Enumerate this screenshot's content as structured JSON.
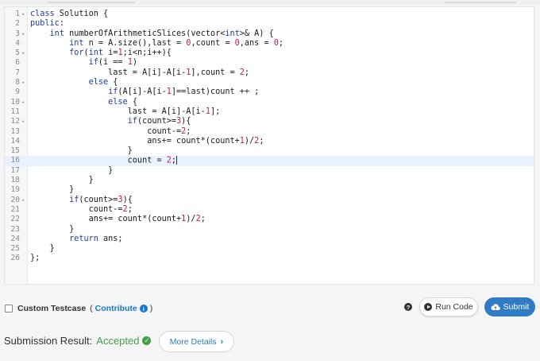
{
  "editor": {
    "active_line": 16,
    "lines": [
      {
        "n": "1",
        "fold": true,
        "tokens": [
          [
            "kw",
            "class"
          ],
          [
            "t",
            " Solution {"
          ]
        ]
      },
      {
        "n": "2",
        "fold": false,
        "tokens": [
          [
            "kw",
            "public"
          ],
          [
            "t",
            ":"
          ]
        ]
      },
      {
        "n": "3",
        "fold": true,
        "tokens": [
          [
            "t",
            "    "
          ],
          [
            "kw",
            "int"
          ],
          [
            "t",
            " numberOfArithmeticSlices(vector<"
          ],
          [
            "kw",
            "int"
          ],
          [
            "t",
            ">& A) {"
          ]
        ]
      },
      {
        "n": "4",
        "fold": false,
        "tokens": [
          [
            "t",
            "        "
          ],
          [
            "kw",
            "int"
          ],
          [
            "t",
            " n = A.size(),last = "
          ],
          [
            "num",
            "0"
          ],
          [
            "t",
            ",count = "
          ],
          [
            "num",
            "0"
          ],
          [
            "t",
            ",ans = "
          ],
          [
            "num",
            "0"
          ],
          [
            "t",
            ";"
          ]
        ]
      },
      {
        "n": "5",
        "fold": true,
        "tokens": [
          [
            "t",
            "        "
          ],
          [
            "kw",
            "for"
          ],
          [
            "t",
            "("
          ],
          [
            "kw",
            "int"
          ],
          [
            "t",
            " i="
          ],
          [
            "num",
            "1"
          ],
          [
            "t",
            ";i<n;i++){"
          ]
        ]
      },
      {
        "n": "6",
        "fold": false,
        "tokens": [
          [
            "t",
            "            "
          ],
          [
            "kw",
            "if"
          ],
          [
            "t",
            "(i == "
          ],
          [
            "num",
            "1"
          ],
          [
            "t",
            ")"
          ]
        ]
      },
      {
        "n": "7",
        "fold": false,
        "tokens": [
          [
            "t",
            "                last = A[i]-A[i-"
          ],
          [
            "num",
            "1"
          ],
          [
            "t",
            "],count = "
          ],
          [
            "num",
            "2"
          ],
          [
            "t",
            ";"
          ]
        ]
      },
      {
        "n": "8",
        "fold": true,
        "tokens": [
          [
            "t",
            "            "
          ],
          [
            "kw",
            "else"
          ],
          [
            "t",
            " {"
          ]
        ]
      },
      {
        "n": "9",
        "fold": false,
        "tokens": [
          [
            "t",
            "                "
          ],
          [
            "kw",
            "if"
          ],
          [
            "t",
            "(A[i]-A[i-"
          ],
          [
            "num",
            "1"
          ],
          [
            "t",
            "]==last)count ++ ;"
          ]
        ]
      },
      {
        "n": "10",
        "fold": true,
        "tokens": [
          [
            "t",
            "                "
          ],
          [
            "kw",
            "else"
          ],
          [
            "t",
            " {"
          ]
        ]
      },
      {
        "n": "11",
        "fold": false,
        "tokens": [
          [
            "t",
            "                    last = A[i]-A[i-"
          ],
          [
            "num",
            "1"
          ],
          [
            "t",
            "];"
          ]
        ]
      },
      {
        "n": "12",
        "fold": true,
        "tokens": [
          [
            "t",
            "                    "
          ],
          [
            "kw",
            "if"
          ],
          [
            "t",
            "(count>="
          ],
          [
            "num",
            "3"
          ],
          [
            "t",
            "){"
          ]
        ]
      },
      {
        "n": "13",
        "fold": false,
        "tokens": [
          [
            "t",
            "                        count-="
          ],
          [
            "num",
            "2"
          ],
          [
            "t",
            ";"
          ]
        ]
      },
      {
        "n": "14",
        "fold": false,
        "tokens": [
          [
            "t",
            "                        ans+= count*(count+"
          ],
          [
            "num",
            "1"
          ],
          [
            "t",
            ")/"
          ],
          [
            "num",
            "2"
          ],
          [
            "t",
            ";"
          ]
        ]
      },
      {
        "n": "15",
        "fold": false,
        "tokens": [
          [
            "t",
            "                    }"
          ]
        ]
      },
      {
        "n": "16",
        "fold": false,
        "tokens": [
          [
            "t",
            "                    count = "
          ],
          [
            "num",
            "2"
          ],
          [
            "t",
            ";"
          ],
          [
            "cursor",
            ""
          ]
        ]
      },
      {
        "n": "17",
        "fold": false,
        "tokens": [
          [
            "t",
            "                }"
          ]
        ]
      },
      {
        "n": "18",
        "fold": false,
        "tokens": [
          [
            "t",
            "            }"
          ]
        ]
      },
      {
        "n": "19",
        "fold": false,
        "tokens": [
          [
            "t",
            "        }"
          ]
        ]
      },
      {
        "n": "20",
        "fold": true,
        "tokens": [
          [
            "t",
            "        "
          ],
          [
            "kw",
            "if"
          ],
          [
            "t",
            "(count>="
          ],
          [
            "num",
            "3"
          ],
          [
            "t",
            "){"
          ]
        ]
      },
      {
        "n": "21",
        "fold": false,
        "tokens": [
          [
            "t",
            "            count-="
          ],
          [
            "num",
            "2"
          ],
          [
            "t",
            ";"
          ]
        ]
      },
      {
        "n": "22",
        "fold": false,
        "tokens": [
          [
            "t",
            "            ans+= count*(count+"
          ],
          [
            "num",
            "1"
          ],
          [
            "t",
            ")/"
          ],
          [
            "num",
            "2"
          ],
          [
            "t",
            ";"
          ]
        ]
      },
      {
        "n": "23",
        "fold": false,
        "tokens": [
          [
            "t",
            "        }"
          ]
        ]
      },
      {
        "n": "24",
        "fold": false,
        "tokens": [
          [
            "t",
            "        "
          ],
          [
            "kw",
            "return"
          ],
          [
            "t",
            " ans;"
          ]
        ]
      },
      {
        "n": "25",
        "fold": false,
        "tokens": [
          [
            "t",
            "    }"
          ]
        ]
      },
      {
        "n": "26",
        "fold": false,
        "tokens": [
          [
            "t",
            "};"
          ]
        ]
      }
    ]
  },
  "testcase": {
    "label": "Custom Testcase",
    "open_paren": "(",
    "contribute_label": "Contribute",
    "close_paren": ")",
    "info_glyph": "i"
  },
  "actions": {
    "help_glyph": "?",
    "run_label": "Run Code",
    "submit_label": "Submit"
  },
  "result": {
    "label": "Submission Result:",
    "status": "Accepted",
    "check_glyph": "✓",
    "more_label": "More Details",
    "chevron": "›"
  },
  "colors": {
    "keyword": "#1e3ba8",
    "number": "#c2185b",
    "accepted": "#43a047",
    "submit_bg": "#2f7bc4",
    "link": "#1976d2"
  }
}
